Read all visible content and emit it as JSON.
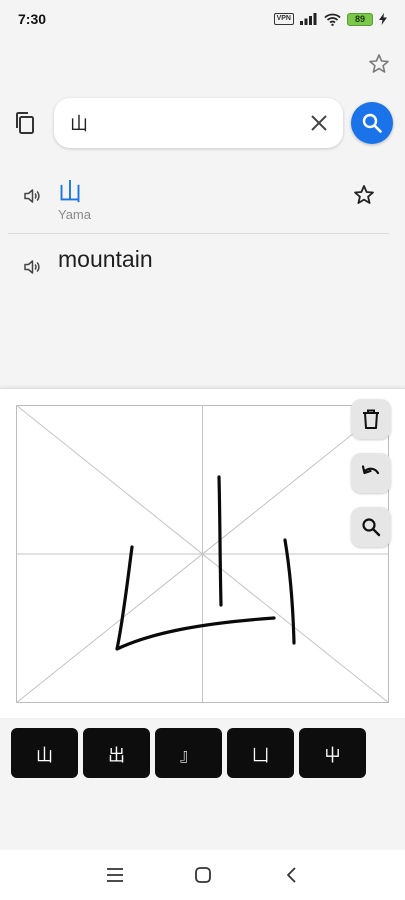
{
  "status_bar": {
    "time": "7:30",
    "vpn": "VPN",
    "battery": "89"
  },
  "search": {
    "query": "山"
  },
  "results": {
    "source_word": "山",
    "romanization": "Yama",
    "translation": "mountain"
  },
  "handwriting": {
    "candidates": [
      "山",
      "出",
      "』",
      "凵",
      "屮"
    ]
  },
  "colors": {
    "accent": "#1a73e8",
    "candidate_bg": "#0d0d0d",
    "battery": "#7cc84a"
  }
}
